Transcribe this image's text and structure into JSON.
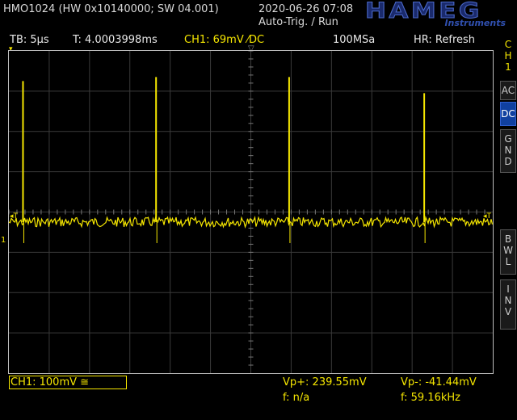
{
  "header": {
    "device": "HMO1024 (HW 0x10140000; SW 04.001)",
    "datetime": "2020-06-26 07:08",
    "trigger_state": "Auto-Trig. / Run",
    "logo_brand": "HAMEG",
    "logo_sub": "Instruments"
  },
  "status_bar": {
    "timebase": "TB: 5µs",
    "time": "T: 4.0003998ms",
    "channel": "CH1: 69mV ⁄DC",
    "sample_rate": "100MSa",
    "hr_mode": "HR: Refresh"
  },
  "side_panel": {
    "channel_tag": [
      "C",
      "H",
      "1"
    ],
    "ac": "AC",
    "dc": "DC",
    "gnd": [
      "G",
      "N",
      "D"
    ],
    "bwl": [
      "B",
      "W",
      "L"
    ],
    "inv": [
      "I",
      "N",
      "V"
    ]
  },
  "markers": {
    "trigger_left": "◂T",
    "trigger_right": "◂T",
    "ground": "1"
  },
  "footer": {
    "ch1_scale": "CH1: 100mV ≅",
    "vp_plus": "Vp+: 239.55mV",
    "vp_minus": "Vp-: -41.44mV",
    "freq1": "f: n/a",
    "freq2": "f: 59.16kHz"
  },
  "colors": {
    "trace": "#f5e600",
    "grid": "#3a3a3a",
    "active_button": "#1040a0"
  },
  "waveform": {
    "baseline_division": -0.25,
    "spike_positions_division": [
      0.35,
      3.65,
      6.95,
      10.3
    ],
    "spike_heights_division": [
      3.5,
      3.6,
      3.6,
      3.2
    ]
  }
}
